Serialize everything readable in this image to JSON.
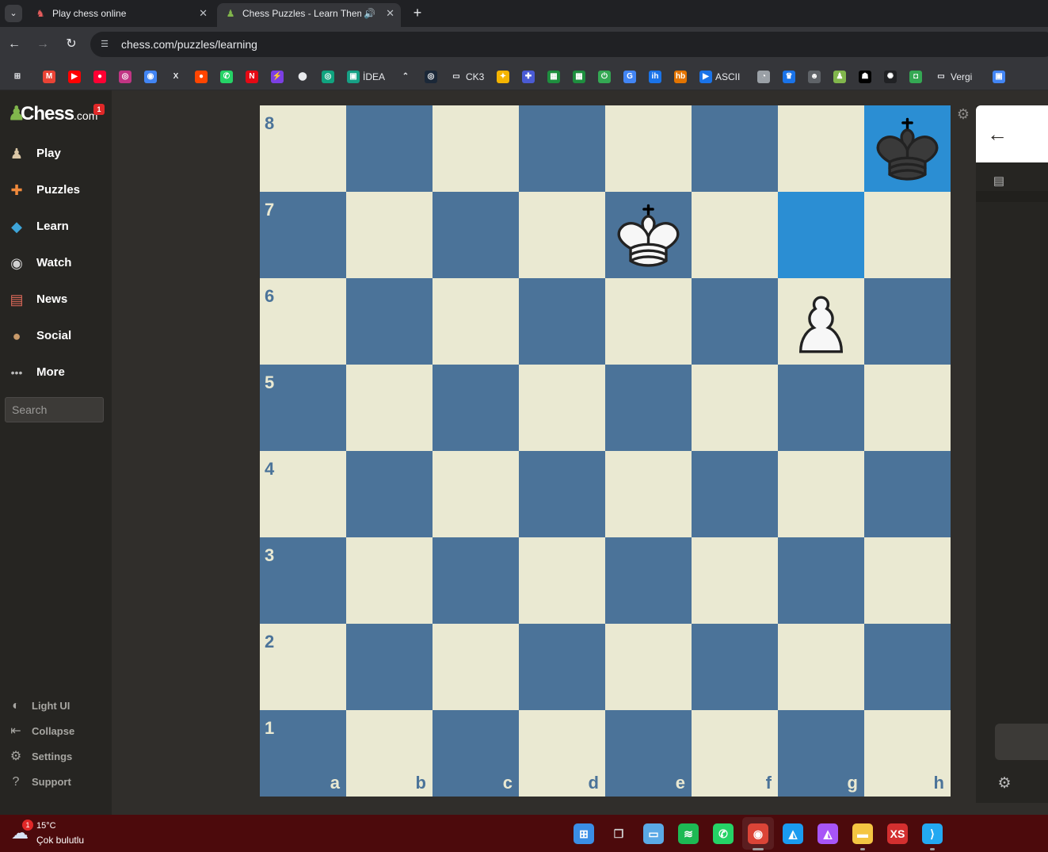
{
  "browser": {
    "tabs": [
      {
        "label": "Play chess online",
        "favicon": "chess-knight-icon"
      },
      {
        "label": "Chess Puzzles - Learn Them",
        "favicon": "chess-pawn-icon",
        "audio": true
      }
    ],
    "url": "chess.com/puzzles/learning",
    "bookmarks": [
      {
        "label": "",
        "icon": "apps-grid-icon"
      },
      {
        "label": "",
        "icon": "gmail-icon"
      },
      {
        "label": "",
        "icon": "youtube-icon"
      },
      {
        "label": "",
        "icon": "youtube-music-icon"
      },
      {
        "label": "",
        "icon": "instagram-icon"
      },
      {
        "label": "",
        "icon": "chrome-app-icon"
      },
      {
        "label": "",
        "icon": "x-icon"
      },
      {
        "label": "",
        "icon": "reddit-icon"
      },
      {
        "label": "",
        "icon": "whatsapp-icon"
      },
      {
        "label": "",
        "icon": "netflix-icon"
      },
      {
        "label": "",
        "icon": "bolt-icon"
      },
      {
        "label": "",
        "icon": "map-pin-icon"
      },
      {
        "label": "",
        "icon": "chatgpt-icon"
      },
      {
        "label": "İDEA",
        "icon": "idea-icon"
      },
      {
        "label": "",
        "icon": "chevron-icon"
      },
      {
        "label": "",
        "icon": "steam-icon"
      },
      {
        "label": "CK3",
        "icon": "folder-icon"
      },
      {
        "label": "",
        "icon": "game-icon"
      },
      {
        "label": "",
        "icon": "puzzle-icon"
      },
      {
        "label": "",
        "icon": "sheets-icon"
      },
      {
        "label": "",
        "icon": "sheets-icon"
      },
      {
        "label": "",
        "icon": "power-icon"
      },
      {
        "label": "",
        "icon": "translate-icon"
      },
      {
        "label": "",
        "icon": "ih-icon"
      },
      {
        "label": "",
        "icon": "hb-icon"
      },
      {
        "label": "ASCII",
        "icon": "play-icon"
      },
      {
        "label": "",
        "icon": "gauge-icon"
      },
      {
        "label": "",
        "icon": "crown-icon"
      },
      {
        "label": "",
        "icon": "alien-icon"
      },
      {
        "label": "",
        "icon": "chess-pawn-icon"
      },
      {
        "label": "",
        "icon": "mask-icon"
      },
      {
        "label": "",
        "icon": "openai-icon"
      },
      {
        "label": "",
        "icon": "android-icon"
      },
      {
        "label": "Vergi",
        "icon": "folder-icon"
      },
      {
        "label": "",
        "icon": "photo-icon"
      },
      {
        "label": "",
        "icon": "wallet-icon"
      },
      {
        "label": "",
        "icon": "p-icon"
      }
    ]
  },
  "sidebar": {
    "logo": {
      "main": "Chess",
      "suffix": ".com",
      "badge": "1"
    },
    "items": [
      {
        "label": "Play",
        "icon": "play-pawn-icon"
      },
      {
        "label": "Puzzles",
        "icon": "puzzle-piece-icon"
      },
      {
        "label": "Learn",
        "icon": "graduation-icon"
      },
      {
        "label": "Watch",
        "icon": "binoculars-icon"
      },
      {
        "label": "News",
        "icon": "newspaper-icon"
      },
      {
        "label": "Social",
        "icon": "people-icon"
      },
      {
        "label": "More",
        "icon": "more-dots-icon"
      }
    ],
    "search_placeholder": "Search",
    "footer": [
      {
        "label": "Light UI",
        "icon": "contrast-icon"
      },
      {
        "label": "Collapse",
        "icon": "collapse-icon"
      },
      {
        "label": "Settings",
        "icon": "gear-icon"
      },
      {
        "label": "Support",
        "icon": "help-icon"
      }
    ]
  },
  "board": {
    "ranks": [
      "8",
      "7",
      "6",
      "5",
      "4",
      "3",
      "2",
      "1"
    ],
    "files": [
      "a",
      "b",
      "c",
      "d",
      "e",
      "f",
      "g",
      "h"
    ],
    "highlights": [
      "h8",
      "g7"
    ],
    "pieces": [
      {
        "square": "h8",
        "type": "king",
        "color": "black"
      },
      {
        "square": "e7",
        "type": "king",
        "color": "white"
      },
      {
        "square": "g6",
        "type": "pawn",
        "color": "white"
      }
    ],
    "colors": {
      "light": "#eae9d2",
      "dark": "#4b7399",
      "highlight": "#2b8ed3"
    }
  },
  "taskbar": {
    "weather": {
      "temp": "15°C",
      "condition": "Çok bulutlu",
      "badge": "1"
    },
    "apps": [
      "windows-start-icon",
      "task-view-icon",
      "photos-icon",
      "spotify-icon",
      "whatsapp-icon",
      "chrome-icon",
      "affinity-designer-icon",
      "affinity-photo-icon",
      "file-explorer-icon",
      "xs-app-icon",
      "vscode-icon"
    ]
  }
}
